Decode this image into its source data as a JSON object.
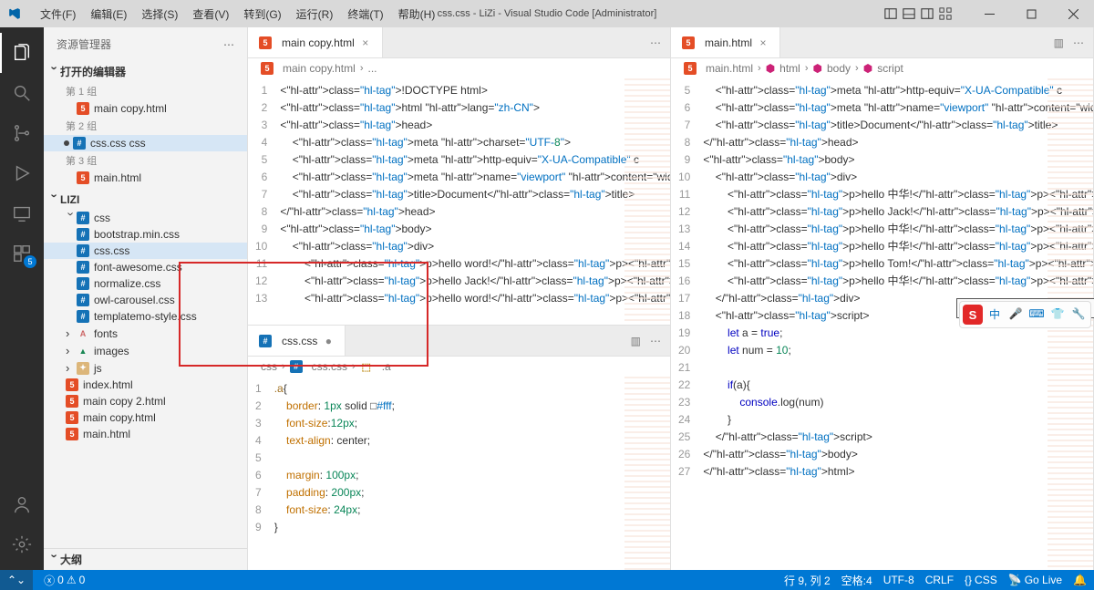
{
  "title": "css.css - LiZi - Visual Studio Code [Administrator]",
  "menu": [
    "文件(F)",
    "编辑(E)",
    "选择(S)",
    "查看(V)",
    "转到(G)",
    "运行(R)",
    "终端(T)",
    "帮助(H)"
  ],
  "sidebar": {
    "title": "资源管理器",
    "sections": {
      "openEditors": "打开的编辑器",
      "outline": "大纲"
    },
    "groups": [
      "第 1 组",
      "第 2 组",
      "第 3 组"
    ],
    "group1": [
      "main copy.html"
    ],
    "group2": [
      "css.css css"
    ],
    "group3": [
      "main.html"
    ],
    "project": "LIZI",
    "folders": {
      "css": {
        "label": "css",
        "items": [
          "bootstrap.min.css",
          "css.css",
          "font-awesome.css",
          "normalize.css",
          "owl-carousel.css",
          "templatemo-style.css"
        ]
      },
      "fonts": "fonts",
      "images": "images",
      "js": "js"
    },
    "files": [
      "index.html",
      "main copy 2.html",
      "main copy.html",
      "main.html"
    ]
  },
  "tabs": {
    "left_top": "main copy.html",
    "left_bot": "css.css",
    "right": "main.html"
  },
  "breadcrumbs": {
    "left_top": [
      "main copy.html",
      "..."
    ],
    "left_bot": [
      "css",
      "css.css",
      ".a"
    ],
    "right": [
      "main.html",
      "html",
      "body",
      "script"
    ]
  },
  "code_left_top": {
    "start": 1,
    "lines": [
      "<!DOCTYPE html>",
      "<html lang=\"zh-CN\">",
      "<head>",
      "    <meta charset=\"UTF-8\">",
      "    <meta http-equiv=\"X-UA-Compatible\" c",
      "    <meta name=\"viewport\" content=\"width",
      "    <title>Document</title>",
      "</head>",
      "<body>",
      "    <div>",
      "        <p>hello word!</p><span></span>",
      "        <p>hello Jack!</p><span></span>",
      "        <p>hello word!</p><span></span>"
    ]
  },
  "code_left_bot": {
    "start": 1,
    "lines": [
      ".a{",
      "    border: 1px solid □#fff;",
      "    font-size:12px;",
      "    text-align: center;",
      "",
      "    margin: 100px;",
      "    padding: 200px;",
      "    font-size: 24px;",
      "}"
    ]
  },
  "code_right": {
    "start": 5,
    "lines": [
      "    <meta http-equiv=\"X-UA-Compatible\" c",
      "    <meta name=\"viewport\" content=\"width",
      "    <title>Document</title>",
      "</head>",
      "<body>",
      "    <div>",
      "        <p>hello 中华!</p><span></span>",
      "        <p>hello Jack!</p><span></span>",
      "        <p>hello 中华!</p><span></span>",
      "        <p>hello 中华!</p><span></span>",
      "        <p>hello Tom!</p><span></span>",
      "        <p>hello 中华!</p><span></span>",
      "    </div>",
      "    <script>",
      "        let a = true;",
      "        let num = 10;",
      "",
      "        if(a){",
      "            console.log(num)",
      "        }",
      "    </script>",
      "</body>",
      "</html>"
    ]
  },
  "badge_ext": "5",
  "status": {
    "errors": "0",
    "warnings": "0",
    "line_col": "行 9, 列 2",
    "spaces": "空格:4",
    "encoding": "UTF-8",
    "eol": "CRLF",
    "lang": "CSS",
    "golive": "Go Live",
    "langicon": "{}"
  },
  "actions": {
    "ellipsis": "⋯",
    "split": "▥"
  }
}
